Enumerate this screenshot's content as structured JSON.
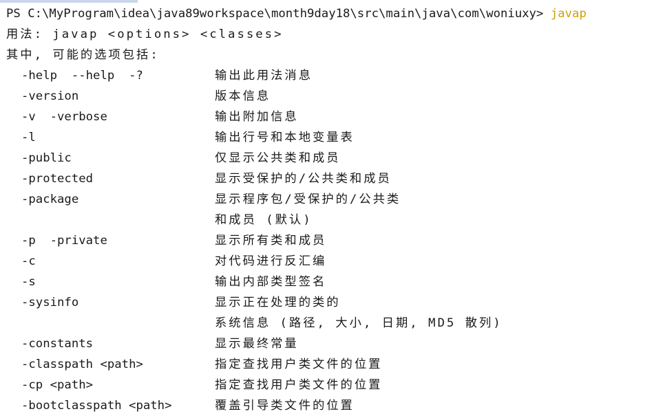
{
  "prompt": {
    "path": "PS C:\\MyProgram\\idea\\java89workspace\\month9day18\\src\\main\\java\\com\\woniuxy> ",
    "command": "javap"
  },
  "usage": "用法: javap <options> <classes>",
  "where": "其中, 可能的选项包括:",
  "options": [
    {
      "flag": "-help  --help  -?",
      "desc": "输出此用法消息"
    },
    {
      "flag": "-version",
      "desc": "版本信息"
    },
    {
      "flag": "-v  -verbose",
      "desc": "输出附加信息"
    },
    {
      "flag": "-l",
      "desc": "输出行号和本地变量表"
    },
    {
      "flag": "-public",
      "desc": "仅显示公共类和成员"
    },
    {
      "flag": "-protected",
      "desc": "显示受保护的/公共类和成员"
    },
    {
      "flag": "-package",
      "desc": "显示程序包/受保护的/公共类"
    },
    {
      "flag": "",
      "desc": "和成员 (默认)"
    },
    {
      "flag": "-p  -private",
      "desc": "显示所有类和成员"
    },
    {
      "flag": "-c",
      "desc": "对代码进行反汇编"
    },
    {
      "flag": "-s",
      "desc": "输出内部类型签名"
    },
    {
      "flag": "-sysinfo",
      "desc": "显示正在处理的类的"
    },
    {
      "flag": "",
      "desc": "系统信息 (路径, 大小, 日期, MD5 散列)"
    },
    {
      "flag": "-constants",
      "desc": "显示最终常量"
    },
    {
      "flag": "-classpath <path>",
      "desc": "指定查找用户类文件的位置"
    },
    {
      "flag": "-cp <path>",
      "desc": "指定查找用户类文件的位置"
    },
    {
      "flag": "-bootclasspath <path>",
      "desc": "覆盖引导类文件的位置"
    }
  ],
  "colors": {
    "background": "#ffffff",
    "text": "#1a1a1a",
    "command": "#cfa100"
  }
}
